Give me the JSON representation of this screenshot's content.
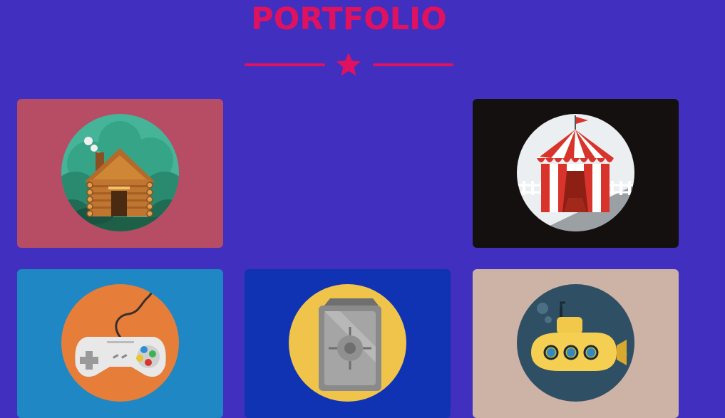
{
  "header": {
    "title": "PORTFOLIO"
  },
  "icons": {
    "divider": "star-icon"
  },
  "colors": {
    "background": "#4130bf",
    "accent": "#e0115f",
    "cabin_card": "#b74d65",
    "circus_card": "#151010",
    "game_card": "#1e87c4",
    "safe_card": "#0f33b3",
    "submarine_card": "#cdb3a5"
  },
  "portfolio": {
    "items": [
      {
        "icon": "log-cabin-icon"
      },
      {
        "icon": "circus-tent-icon"
      },
      {
        "icon": "game-controller-icon"
      },
      {
        "icon": "safe-icon"
      },
      {
        "icon": "submarine-icon"
      }
    ]
  }
}
